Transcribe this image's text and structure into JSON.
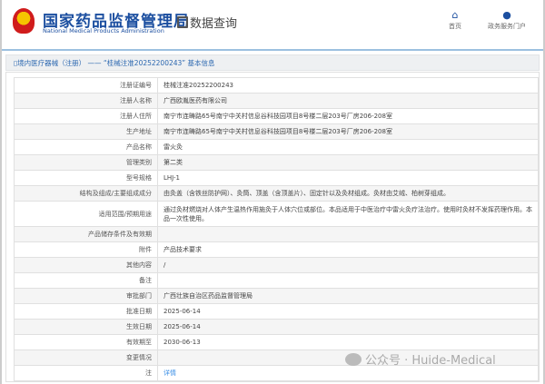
{
  "header": {
    "title_cn": "国家药品监督管理局",
    "title_en": "National Medical Products Administration",
    "section": "数据查询",
    "nav": [
      {
        "label": "首页",
        "icon": "home-icon"
      },
      {
        "label": "政务服务门户",
        "icon": "user-icon"
      }
    ]
  },
  "breadcrumb": "境内医疗器械（注册） —— “桂械注准20252200243” 基本信息",
  "rows": [
    {
      "label": "注册证编号",
      "value": "桂械注准20252200243"
    },
    {
      "label": "注册人名称",
      "value": "广西欧胤医药有限公司"
    },
    {
      "label": "注册人住所",
      "value": "南宁市连畴路65号南宁中关村信息谷科技园项目8号楼二层203号厂房206-208室"
    },
    {
      "label": "生产地址",
      "value": "南宁市连畴路65号南宁中关村信息谷科技园项目8号楼二层203号厂房206-208室"
    },
    {
      "label": "产品名称",
      "value": "雷火灸"
    },
    {
      "label": "管理类别",
      "value": "第二类"
    },
    {
      "label": "型号规格",
      "value": "LHJ-1"
    },
    {
      "label": "结构及组成/主要组成成分",
      "value": "由灸盖（含铁丝防护网）、灸筒、顶盖（含顶盖片）、固定针以及灸材组成。灸材由艾绒、柏树芽组成。"
    },
    {
      "label": "适用范围/预期用途",
      "value": "通过灸材燃烧对人体产生温热作用施灸于人体穴位或部位。本品适用于中医治疗中雷火灸疗法治疗。使用时灸材不发挥药理作用。本品一次性使用。"
    },
    {
      "label": "产品储存条件及有效期",
      "value": ""
    },
    {
      "label": "附件",
      "value": "产品技术要求"
    },
    {
      "label": "其他内容",
      "value": "/"
    },
    {
      "label": "备注",
      "value": ""
    },
    {
      "label": "审批部门",
      "value": "广西壮族自治区药品监督管理局"
    },
    {
      "label": "批准日期",
      "value": "2025-06-14"
    },
    {
      "label": "生效日期",
      "value": "2025-06-14"
    },
    {
      "label": "有效期至",
      "value": "2030-06-13"
    },
    {
      "label": "变更情况",
      "value": ""
    },
    {
      "label": "注",
      "value": "详情"
    }
  ],
  "watermark": "公众号 · Huide-Medical"
}
